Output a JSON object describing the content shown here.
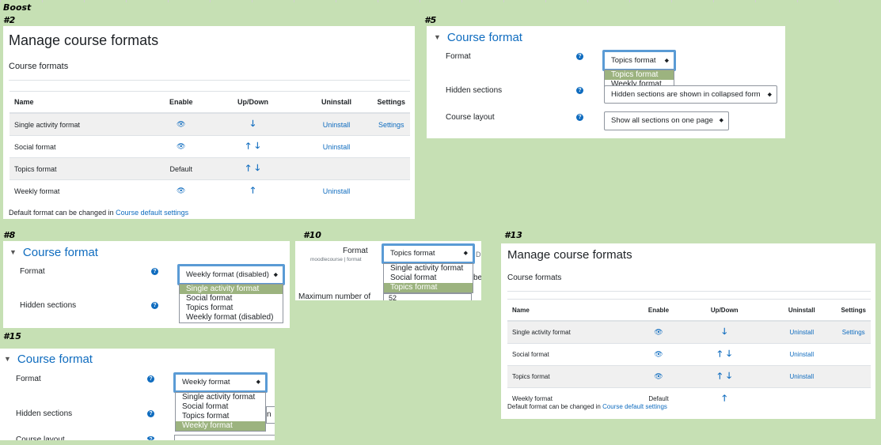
{
  "theme_label": "Boost",
  "case_labels": [
    "#2",
    "#5",
    "#8",
    "#10",
    "#13",
    "#15"
  ],
  "manage_a": {
    "title": "Manage course formats",
    "subtitle": "Course formats",
    "headers": [
      "Name",
      "Enable",
      "Up/Down",
      "Uninstall",
      "Settings"
    ],
    "rows": [
      {
        "name": "Single activity format",
        "enable": "eye",
        "updown": "down",
        "uninstall": "Uninstall",
        "settings": "Settings"
      },
      {
        "name": "Social format",
        "enable": "eye",
        "updown": "updown",
        "uninstall": "Uninstall",
        "settings": ""
      },
      {
        "name": "Topics format",
        "enable": "Default",
        "updown": "updown",
        "uninstall": "",
        "settings": ""
      },
      {
        "name": "Weekly format",
        "enable": "eye",
        "updown": "up",
        "uninstall": "Uninstall",
        "settings": ""
      }
    ],
    "footer_text": "Default format can be changed in ",
    "footer_link": "Course default settings"
  },
  "manage_b": {
    "title": "Manage course formats",
    "subtitle": "Course formats",
    "headers": [
      "Name",
      "Enable",
      "Up/Down",
      "Uninstall",
      "Settings"
    ],
    "rows": [
      {
        "name": "Single activity format",
        "enable": "eye",
        "updown": "down",
        "uninstall": "Uninstall",
        "settings": "Settings"
      },
      {
        "name": "Social format",
        "enable": "eye",
        "updown": "updown",
        "uninstall": "Uninstall",
        "settings": ""
      },
      {
        "name": "Topics format",
        "enable": "eye",
        "updown": "updown",
        "uninstall": "Uninstall",
        "settings": ""
      },
      {
        "name": "Weekly format",
        "enable": "Default",
        "updown": "up",
        "uninstall": "",
        "settings": ""
      }
    ],
    "footer_text": "Default format can be changed in ",
    "footer_link": "Course default settings"
  },
  "cf5": {
    "heading": "Course format",
    "format_label": "Format",
    "format_value": "Topics format",
    "options": [
      "Topics format",
      "Weekly format"
    ],
    "selected_option": "Topics format",
    "hidden_label": "Hidden sections",
    "hidden_value": "Hidden sections are shown in collapsed form",
    "layout_label": "Course layout",
    "layout_value": "Show all sections on one page"
  },
  "cf8": {
    "heading": "Course format",
    "format_label": "Format",
    "format_value": "Weekly format (disabled)",
    "options": [
      "Single activity format",
      "Social format",
      "Topics format",
      "Weekly format (disabled)"
    ],
    "selected_option": "Single activity format",
    "hidden_label": "Hidden sections"
  },
  "cf10": {
    "format_label": "Format",
    "format_sub": "moodlecourse | format",
    "format_value": "Topics format",
    "right_partial": "D",
    "right_partial2": "be",
    "options": [
      "Single activity format",
      "Social format",
      "Topics format"
    ],
    "selected_option": "Topics format",
    "max_label": "Maximum number of",
    "max_value": "52"
  },
  "cf15": {
    "heading": "Course format",
    "format_label": "Format",
    "format_value": "Weekly format",
    "options": [
      "Single activity format",
      "Social format",
      "Topics format",
      "Weekly format"
    ],
    "selected_option": "Weekly format",
    "hidden_label": "Hidden sections",
    "hidden_partial": "n",
    "layout_label": "Course layout"
  },
  "colors": {
    "background": "#c6e0b4",
    "link": "#0f6cbf",
    "focus": "#5a9bd5",
    "selected_option": "#9cb37f"
  }
}
